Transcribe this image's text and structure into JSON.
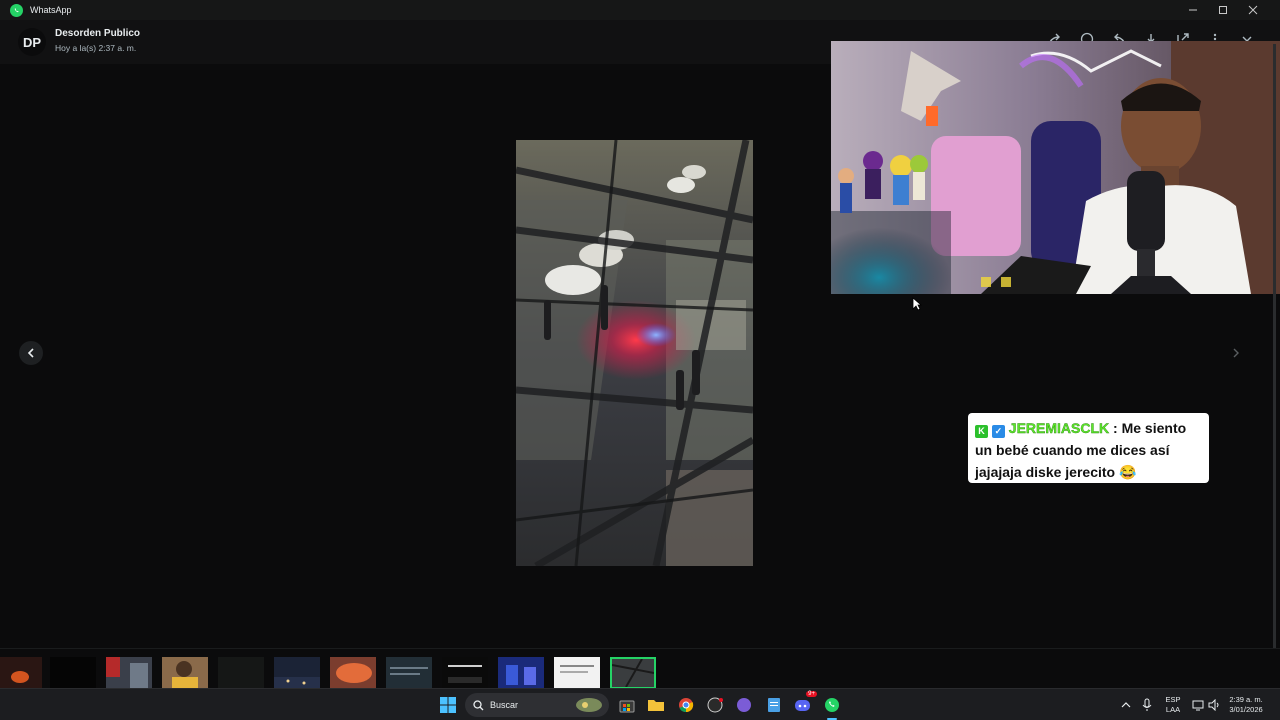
{
  "window": {
    "title": "WhatsApp"
  },
  "header": {
    "avatar_initials": "DP",
    "sender_name": "Desorden Publico",
    "timestamp": "Hoy a la(s) 2:37 a. m."
  },
  "chat_overlay": {
    "username": "JEREMIASCLK",
    "separator": " : ",
    "message": "Me siento un bebé cuando me dices así jajajaja diske jerecito",
    "emoji": "😂"
  },
  "taskbar": {
    "search_placeholder": "Buscar",
    "language_line1": "ESP",
    "language_line2": "LAA",
    "time": "2:39 a. m.",
    "date": "3/01/2026",
    "discord_badge": "9+"
  },
  "icons": {
    "app": "whatsapp-icon",
    "prev": "chevron-left-icon",
    "next": "chevron-right-icon"
  },
  "colors": {
    "accent": "#25d366",
    "chat_username": "#5de82b"
  }
}
